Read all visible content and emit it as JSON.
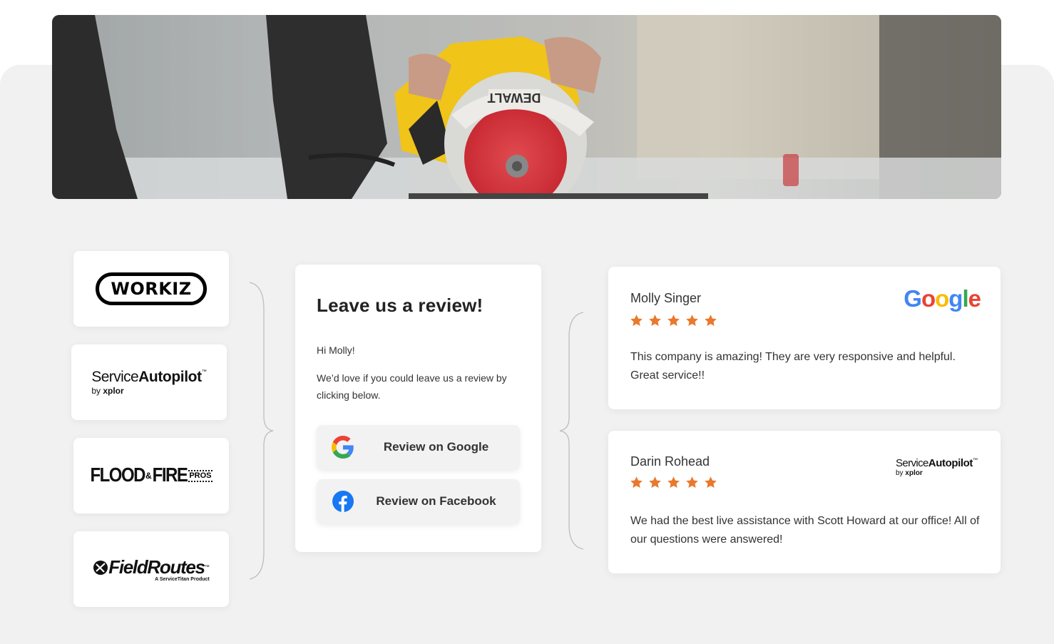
{
  "hero": {
    "image": "circular-saw-cutting-photo"
  },
  "integrations": [
    {
      "name": "WORKIZ",
      "icon": "workiz-logo"
    },
    {
      "name_light": "Service",
      "name_bold": "Autopilot",
      "tm": "™",
      "by": "by",
      "by_brand": "xplor",
      "icon": "service-autopilot-logo"
    },
    {
      "name_main": "FLOOD",
      "amp": "&",
      "name_second": "FIRE",
      "pros": "PROS",
      "icon": "flood-fire-pros-logo"
    },
    {
      "name": "FieldRoutes",
      "tm": "™",
      "sub": "A ServiceTitan Product",
      "icon": "fieldroutes-logo"
    }
  ],
  "review_request": {
    "title": "Leave us a review!",
    "greeting": "Hi Molly!",
    "message": "We’d love if you could leave us a review by clicking below.",
    "buttons": [
      {
        "label": "Review on Google",
        "icon": "google-icon"
      },
      {
        "label": "Review on Facebook",
        "icon": "facebook-icon"
      }
    ]
  },
  "testimonials": [
    {
      "name": "Molly Singer",
      "rating": 5,
      "text": "This company is amazing! They are very responsive and helpful. Great service!!",
      "source": "Google",
      "source_letters": [
        "G",
        "o",
        "o",
        "g",
        "l",
        "e"
      ]
    },
    {
      "name": "Darin Rohead",
      "rating": 5,
      "text": "We had the best live assistance with Scott Howard at our office! All of our questions were answered!",
      "source_light": "Service",
      "source_bold": "Autopilot",
      "source_tm": "™",
      "source_by": "by",
      "source_by_brand": "xplor"
    }
  ],
  "colors": {
    "background": "#f1f1f1",
    "card": "#ffffff",
    "star": "#e8792d",
    "google_blue": "#4285F4",
    "google_red": "#EA4335",
    "google_yellow": "#FBBC05",
    "google_green": "#34A853",
    "facebook_blue": "#1877F2"
  }
}
